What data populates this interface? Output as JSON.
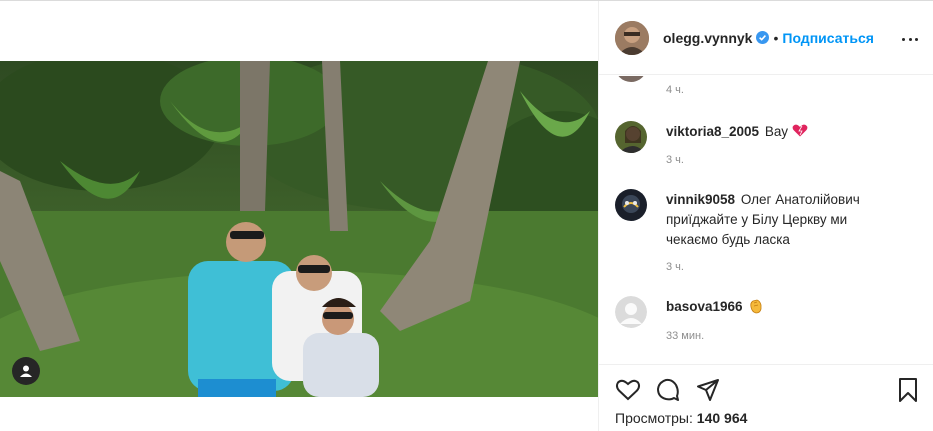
{
  "post": {
    "author": {
      "username": "olegg.vynnyk",
      "verified": true,
      "separator": "•",
      "follow_label": "Подписаться"
    },
    "views_label": "Просмотры:",
    "views_count": "140 964"
  },
  "comments": {
    "first_time": "4 ч.",
    "items": [
      {
        "username": "viktoria8_2005",
        "text": "Вау",
        "emoji": "heart-emoji",
        "time": "3 ч."
      },
      {
        "username": "vinnik9058",
        "text": "Олег Анатолійович приїджайте у Білу Церкву ми чекаємо будь ласка",
        "time": "3 ч."
      },
      {
        "username": "basova1966",
        "text": "",
        "emoji": "clapping-hands-emoji",
        "time": "33 мин."
      }
    ]
  },
  "icons": {
    "verified": "verified-badge-icon",
    "more": "more-options-icon",
    "like": "heart-icon",
    "comment": "comment-icon",
    "share": "paper-plane-icon",
    "save": "bookmark-icon",
    "user_tag": "user-icon"
  },
  "colors": {
    "link_blue": "#0095f6",
    "verified_blue": "#3897f0",
    "muted": "#8e8e8e",
    "text": "#262626"
  }
}
